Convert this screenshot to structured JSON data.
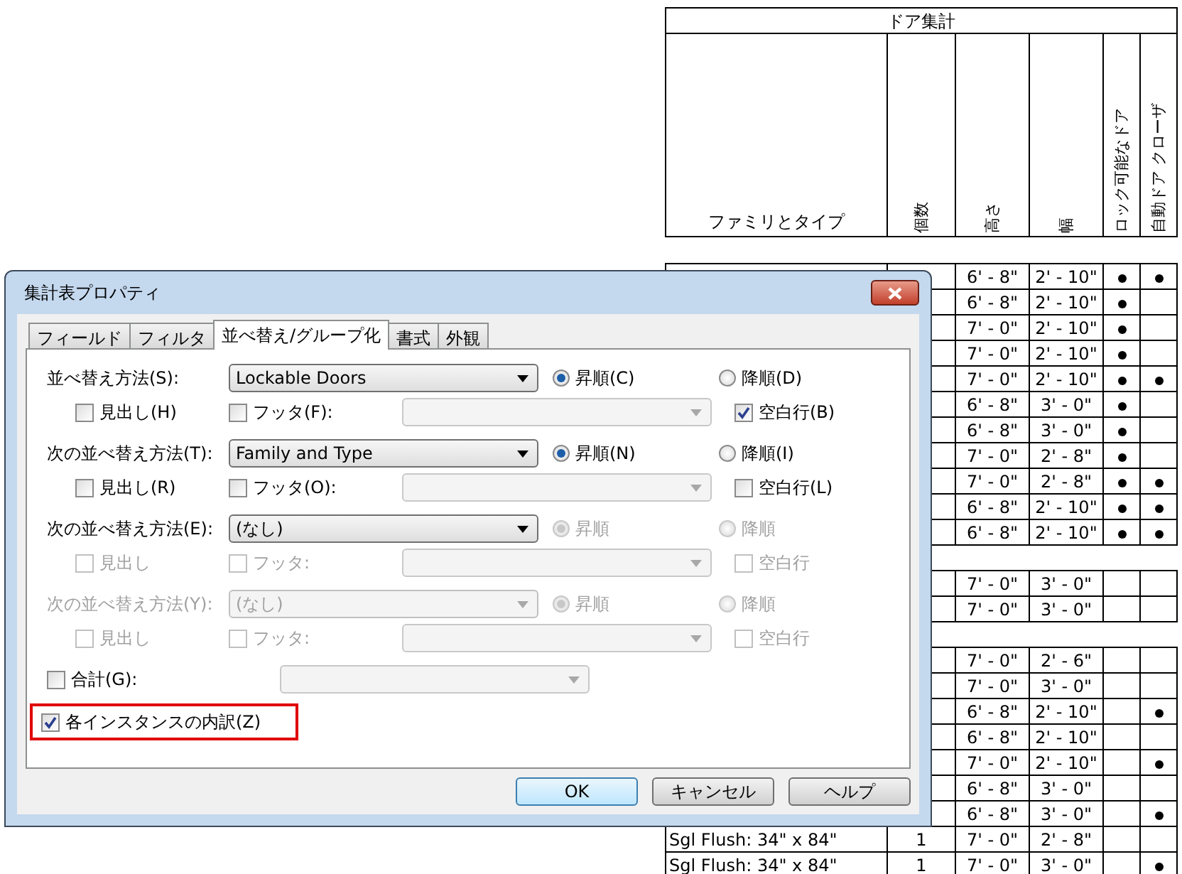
{
  "schedule": {
    "title": "ドア集計",
    "columns": [
      {
        "label": "ファミリとタイプ",
        "vertical": false
      },
      {
        "label": "個数",
        "vertical": true
      },
      {
        "label": "高さ",
        "vertical": true
      },
      {
        "label": "幅",
        "vertical": true
      },
      {
        "label": "ロック可能なドア",
        "vertical": true
      },
      {
        "label": "自動ドア クローザ",
        "vertical": true
      }
    ],
    "rows": [
      {
        "kind": "data",
        "height": "6' - 8\"",
        "width": "2' - 10\"",
        "lockable": true,
        "closer": true
      },
      {
        "kind": "data",
        "height": "6' - 8\"",
        "width": "2' - 10\"",
        "lockable": true,
        "closer": false
      },
      {
        "kind": "data",
        "height": "7' - 0\"",
        "width": "2' - 10\"",
        "lockable": true,
        "closer": false
      },
      {
        "kind": "data",
        "height": "7' - 0\"",
        "width": "2' - 10\"",
        "lockable": true,
        "closer": false
      },
      {
        "kind": "data",
        "height": "7' - 0\"",
        "width": "2' - 10\"",
        "lockable": true,
        "closer": true
      },
      {
        "kind": "data",
        "height": "6' - 8\"",
        "width": "3' - 0\"",
        "lockable": true,
        "closer": false
      },
      {
        "kind": "data",
        "height": "6' - 8\"",
        "width": "3' - 0\"",
        "lockable": true,
        "closer": false
      },
      {
        "kind": "data",
        "height": "7' - 0\"",
        "width": "2' - 8\"",
        "lockable": true,
        "closer": false
      },
      {
        "kind": "data",
        "height": "7' - 0\"",
        "width": "2' - 8\"",
        "lockable": true,
        "closer": true
      },
      {
        "kind": "data",
        "height": "6' - 8\"",
        "width": "2' - 10\"",
        "lockable": true,
        "closer": true
      },
      {
        "kind": "data",
        "height": "6' - 8\"",
        "width": "2' - 10\"",
        "lockable": true,
        "closer": true
      },
      {
        "kind": "blank"
      },
      {
        "kind": "data",
        "height": "7' - 0\"",
        "width": "3' - 0\"",
        "lockable": false,
        "closer": false
      },
      {
        "kind": "data",
        "height": "7' - 0\"",
        "width": "3' - 0\"",
        "lockable": false,
        "closer": false
      },
      {
        "kind": "blank"
      },
      {
        "kind": "data",
        "height": "7' - 0\"",
        "width": "2' - 6\"",
        "lockable": false,
        "closer": false
      },
      {
        "kind": "data",
        "height": "7' - 0\"",
        "width": "3' - 0\"",
        "lockable": false,
        "closer": false
      },
      {
        "kind": "data",
        "height": "6' - 8\"",
        "width": "2' - 10\"",
        "lockable": false,
        "closer": true
      },
      {
        "kind": "data",
        "height": "6' - 8\"",
        "width": "2' - 10\"",
        "lockable": false,
        "closer": false
      },
      {
        "kind": "data",
        "height": "7' - 0\"",
        "width": "2' - 10\"",
        "lockable": false,
        "closer": true
      },
      {
        "kind": "data",
        "height": "6' - 8\"",
        "width": "3' - 0\"",
        "lockable": false,
        "closer": false
      },
      {
        "kind": "data",
        "height": "6' - 8\"",
        "width": "3' - 0\"",
        "lockable": false,
        "closer": true
      },
      {
        "kind": "data",
        "family": "Sgl Flush: 34\" x 84\"",
        "count": "1",
        "height": "7' - 0\"",
        "width": "2' - 8\"",
        "lockable": false,
        "closer": false
      },
      {
        "kind": "data",
        "family": "Sgl Flush: 34\" x 84\"",
        "count": "1",
        "height": "7' - 0\"",
        "width": "3' - 0\"",
        "lockable": false,
        "closer": true
      }
    ]
  },
  "dialog": {
    "title": "集計表プロパティ",
    "tabs": [
      {
        "label": "フィールド",
        "selected": false
      },
      {
        "label": "フィルタ",
        "selected": false
      },
      {
        "label": "並べ替え/グループ化",
        "selected": true
      },
      {
        "label": "書式",
        "selected": false
      },
      {
        "label": "外観",
        "selected": false
      }
    ],
    "sort_levels": [
      {
        "label": "並べ替え方法(S):",
        "disabled": false,
        "field": {
          "value": "Lockable Doors",
          "disabled": false
        },
        "ascending": {
          "label": "昇順(C)",
          "selected": true,
          "disabled": false
        },
        "descending": {
          "label": "降順(D)",
          "selected": false,
          "disabled": false
        },
        "header": {
          "label": "見出し(H)",
          "checked": false,
          "disabled": false
        },
        "footer": {
          "label": "フッタ(F):",
          "checked": false,
          "disabled": false
        },
        "blank_line": {
          "label": "空白行(B)",
          "checked": true,
          "disabled": false
        }
      },
      {
        "label": "次の並べ替え方法(T):",
        "disabled": false,
        "field": {
          "value": "Family and Type",
          "disabled": false
        },
        "ascending": {
          "label": "昇順(N)",
          "selected": true,
          "disabled": false
        },
        "descending": {
          "label": "降順(I)",
          "selected": false,
          "disabled": false
        },
        "header": {
          "label": "見出し(R)",
          "checked": false,
          "disabled": false
        },
        "footer": {
          "label": "フッタ(O):",
          "checked": false,
          "disabled": false
        },
        "blank_line": {
          "label": "空白行(L)",
          "checked": false,
          "disabled": false
        }
      },
      {
        "label": "次の並べ替え方法(E):",
        "disabled": false,
        "field": {
          "value": "(なし)",
          "disabled": false
        },
        "ascending": {
          "label": "昇順",
          "selected": true,
          "disabled": true
        },
        "descending": {
          "label": "降順",
          "selected": false,
          "disabled": true
        },
        "header": {
          "label": "見出し",
          "checked": false,
          "disabled": true
        },
        "footer": {
          "label": "フッタ:",
          "checked": false,
          "disabled": true
        },
        "blank_line": {
          "label": "空白行",
          "checked": false,
          "disabled": true
        }
      },
      {
        "label": "次の並べ替え方法(Y):",
        "disabled": true,
        "field": {
          "value": "(なし)",
          "disabled": true
        },
        "ascending": {
          "label": "昇順",
          "selected": true,
          "disabled": true
        },
        "descending": {
          "label": "降順",
          "selected": false,
          "disabled": true
        },
        "header": {
          "label": "見出し",
          "checked": false,
          "disabled": true
        },
        "footer": {
          "label": "フッタ:",
          "checked": false,
          "disabled": true
        },
        "blank_line": {
          "label": "空白行",
          "checked": false,
          "disabled": true
        }
      }
    ],
    "grand_total": {
      "label": "合計(G):",
      "checked": false
    },
    "itemize": {
      "label": "各インスタンスの内訳(Z)",
      "checked": true,
      "highlighted": true
    },
    "buttons": [
      {
        "label": "OK",
        "default": true
      },
      {
        "label": "キャンセル",
        "default": false
      },
      {
        "label": "ヘルプ",
        "default": false
      }
    ]
  }
}
